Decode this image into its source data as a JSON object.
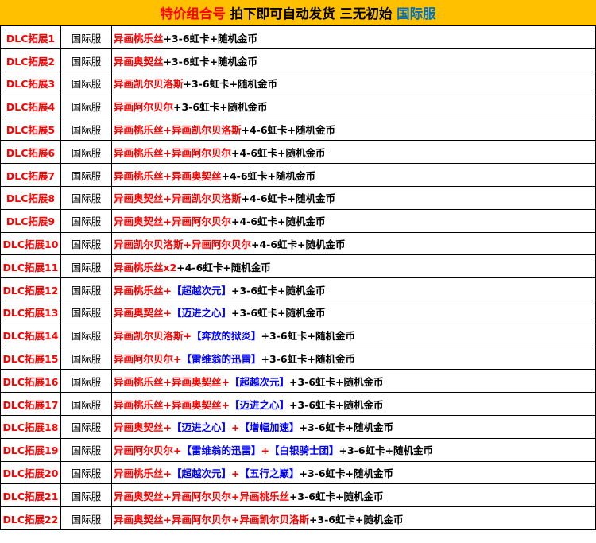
{
  "header": {
    "segments": [
      {
        "text": "特价组合号 ",
        "color": "red"
      },
      {
        "text": "拍下即可自动发货 三无初始 ",
        "color": "black"
      },
      {
        "text": "国际服",
        "color": "blue"
      }
    ]
  },
  "colors": {
    "red": "#ff0000",
    "blue": "#0000ff",
    "header_bg": "#ffc000"
  },
  "rows": [
    {
      "id": "DLC拓展1",
      "server": "国际服",
      "content": [
        {
          "t": "异画桃乐丝",
          "c": "red"
        },
        {
          "t": "+3-6虹卡+随机金币",
          "c": "black"
        }
      ]
    },
    {
      "id": "DLC拓展2",
      "server": "国际服",
      "content": [
        {
          "t": "异画奥契丝",
          "c": "red"
        },
        {
          "t": "+3-6虹卡+随机金币",
          "c": "black"
        }
      ]
    },
    {
      "id": "DLC拓展3",
      "server": "国际服",
      "content": [
        {
          "t": "异画凯尔贝洛斯",
          "c": "red"
        },
        {
          "t": "+3-6虹卡+随机金币",
          "c": "black"
        }
      ]
    },
    {
      "id": "DLC拓展4",
      "server": "国际服",
      "content": [
        {
          "t": "异画阿尔贝尔",
          "c": "red"
        },
        {
          "t": "+3-6虹卡+随机金币",
          "c": "black"
        }
      ]
    },
    {
      "id": "DLC拓展5",
      "server": "国际服",
      "content": [
        {
          "t": "异画桃乐丝+异画凯尔贝洛斯",
          "c": "red"
        },
        {
          "t": "+4-6虹卡+随机金币",
          "c": "black"
        }
      ]
    },
    {
      "id": "DLC拓展6",
      "server": "国际服",
      "content": [
        {
          "t": "异画桃乐丝+异画阿尔贝尔",
          "c": "red"
        },
        {
          "t": "+4-6虹卡+随机金币",
          "c": "black"
        }
      ]
    },
    {
      "id": "DLC拓展7",
      "server": "国际服",
      "content": [
        {
          "t": "异画桃乐丝+异画奥契丝",
          "c": "red"
        },
        {
          "t": "+4-6虹卡+随机金币",
          "c": "black"
        }
      ]
    },
    {
      "id": "DLC拓展8",
      "server": "国际服",
      "content": [
        {
          "t": "异画奥契丝+异画凯尔贝洛斯",
          "c": "red"
        },
        {
          "t": "+4-6虹卡+随机金币",
          "c": "black"
        }
      ]
    },
    {
      "id": "DLC拓展9",
      "server": "国际服",
      "content": [
        {
          "t": "异画奥契丝+异画阿尔贝尔",
          "c": "red"
        },
        {
          "t": "+4-6虹卡+随机金币",
          "c": "black"
        }
      ]
    },
    {
      "id": "DLC拓展10",
      "server": "国际服",
      "content": [
        {
          "t": "异画凯尔贝洛斯+异画阿尔贝尔",
          "c": "red"
        },
        {
          "t": "+4-6虹卡+随机金币",
          "c": "black"
        }
      ]
    },
    {
      "id": "DLC拓展11",
      "server": "国际服",
      "content": [
        {
          "t": "异画桃乐丝x2",
          "c": "red"
        },
        {
          "t": "+4-6虹卡+随机金币",
          "c": "black"
        }
      ]
    },
    {
      "id": "DLC拓展12",
      "server": "国际服",
      "content": [
        {
          "t": "异画桃乐丝+",
          "c": "red"
        },
        {
          "t": "【超越次元】",
          "c": "blue"
        },
        {
          "t": "+3-6虹卡+随机金币",
          "c": "black"
        }
      ]
    },
    {
      "id": "DLC拓展13",
      "server": "国际服",
      "content": [
        {
          "t": "异画奥契丝+",
          "c": "red"
        },
        {
          "t": "【迈进之心】",
          "c": "blue"
        },
        {
          "t": "+3-6虹卡+随机金币",
          "c": "black"
        }
      ]
    },
    {
      "id": "DLC拓展14",
      "server": "国际服",
      "content": [
        {
          "t": "异画凯尔贝洛斯+",
          "c": "red"
        },
        {
          "t": "【奔放的狱炎】",
          "c": "blue"
        },
        {
          "t": "+3-6虹卡+随机金币",
          "c": "black"
        }
      ]
    },
    {
      "id": "DLC拓展15",
      "server": "国际服",
      "content": [
        {
          "t": "异画阿尔贝尔+",
          "c": "red"
        },
        {
          "t": "【雷维翁的迅雷】",
          "c": "blue"
        },
        {
          "t": "+3-6虹卡+随机金币",
          "c": "black"
        }
      ]
    },
    {
      "id": "DLC拓展16",
      "server": "国际服",
      "content": [
        {
          "t": "异画桃乐丝+异画奥契丝+",
          "c": "red"
        },
        {
          "t": "【超越次元】",
          "c": "blue"
        },
        {
          "t": "+3-6虹卡+随机金币",
          "c": "black"
        }
      ]
    },
    {
      "id": "DLC拓展17",
      "server": "国际服",
      "content": [
        {
          "t": "异画桃乐丝+异画奥契丝+",
          "c": "red"
        },
        {
          "t": "【迈进之心】",
          "c": "blue"
        },
        {
          "t": "+3-6虹卡+随机金币",
          "c": "black"
        }
      ]
    },
    {
      "id": "DLC拓展18",
      "server": "国际服",
      "content": [
        {
          "t": "异画奥契丝+",
          "c": "red"
        },
        {
          "t": "【迈进之心】",
          "c": "blue"
        },
        {
          "t": "+",
          "c": "red"
        },
        {
          "t": "【增幅加速】",
          "c": "blue"
        },
        {
          "t": "+3-6虹卡+随机金币",
          "c": "black"
        }
      ]
    },
    {
      "id": "DLC拓展19",
      "server": "国际服",
      "content": [
        {
          "t": "异画阿尔贝尔+",
          "c": "red"
        },
        {
          "t": "【雷维翁的迅雷】",
          "c": "blue"
        },
        {
          "t": "+",
          "c": "red"
        },
        {
          "t": "【白银骑士团】",
          "c": "blue"
        },
        {
          "t": "+3-6虹卡+随机金币",
          "c": "black"
        }
      ]
    },
    {
      "id": "DLC拓展20",
      "server": "国际服",
      "content": [
        {
          "t": "异画桃乐丝+",
          "c": "red"
        },
        {
          "t": "【超越次元】",
          "c": "blue"
        },
        {
          "t": "+",
          "c": "red"
        },
        {
          "t": "【五行之巅】",
          "c": "blue"
        },
        {
          "t": "+3-6虹卡+随机金币",
          "c": "black"
        }
      ]
    },
    {
      "id": "DLC拓展21",
      "server": "国际服",
      "content": [
        {
          "t": "异画奥契丝+异画阿尔贝尔+异画桃乐丝",
          "c": "red"
        },
        {
          "t": "+3-6虹卡+随机金币",
          "c": "black"
        }
      ]
    },
    {
      "id": "DLC拓展22",
      "server": "国际服",
      "content": [
        {
          "t": "异画奥契丝+异画阿尔贝尔+异画凯尔贝洛斯",
          "c": "red"
        },
        {
          "t": "+3-6虹卡+随机金币",
          "c": "black"
        }
      ]
    }
  ]
}
